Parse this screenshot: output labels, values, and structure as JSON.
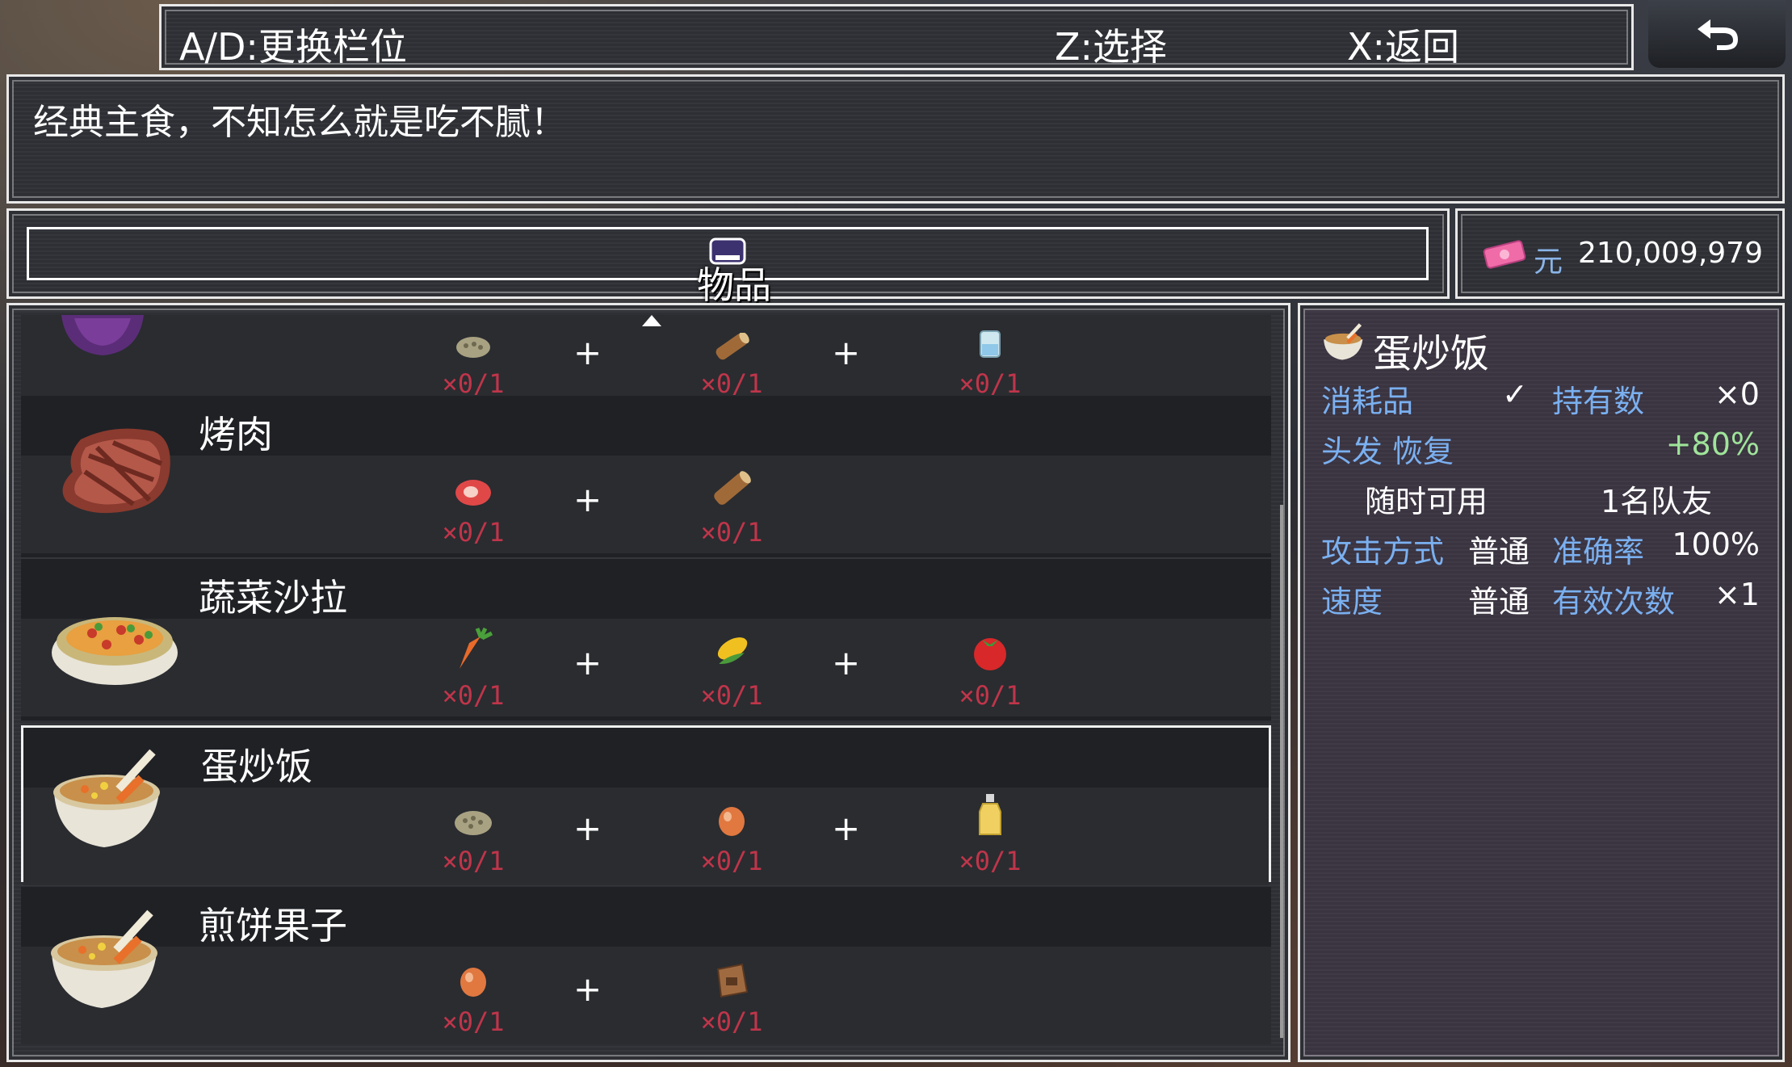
{
  "header": {
    "hint_switch": "A/D:更换栏位",
    "hint_select": "Z:选择",
    "hint_back": "X:返回",
    "back_icon": "return-arrow-icon"
  },
  "description": "经典主食，不知怎么就是吃不腻！",
  "category": {
    "label": "物品",
    "icon": "bag-icon"
  },
  "money": {
    "icon": "banknote-icon",
    "unit": "元",
    "value": "210,009,979"
  },
  "recipes": [
    {
      "name": "",
      "icon": "purple-bowl-icon",
      "ingredients": [
        {
          "icon": "grain-icon",
          "count": "×0/1"
        },
        {
          "icon": "wood-icon",
          "count": "×0/1"
        },
        {
          "icon": "water-cup-icon",
          "count": "×0/1"
        }
      ],
      "plus": "+"
    },
    {
      "name": "烤肉",
      "icon": "steak-icon",
      "ingredients": [
        {
          "icon": "raw-meat-icon",
          "count": "×0/1"
        },
        {
          "icon": "wood-icon",
          "count": "×0/1"
        }
      ],
      "plus": "+"
    },
    {
      "name": "蔬菜沙拉",
      "icon": "salad-icon",
      "ingredients": [
        {
          "icon": "carrot-icon",
          "count": "×0/1"
        },
        {
          "icon": "corn-icon",
          "count": "×0/1"
        },
        {
          "icon": "tomato-icon",
          "count": "×0/1"
        }
      ],
      "plus": "+"
    },
    {
      "name": "蛋炒饭",
      "icon": "fried-rice-icon",
      "selected": true,
      "ingredients": [
        {
          "icon": "grain-icon",
          "count": "×0/1"
        },
        {
          "icon": "egg-icon",
          "count": "×0/1"
        },
        {
          "icon": "oil-bottle-icon",
          "count": "×0/1"
        }
      ],
      "plus": "+"
    },
    {
      "name": "煎饼果子",
      "icon": "fried-rice-icon",
      "ingredients": [
        {
          "icon": "egg-icon",
          "count": "×0/1"
        },
        {
          "icon": "flour-bag-icon",
          "count": "×0/1"
        }
      ],
      "plus": "+"
    }
  ],
  "detail": {
    "title": "蛋炒饭",
    "type_label": "消耗品",
    "type_check": "✓",
    "owned_label": "持有数",
    "owned_value": "×0",
    "effect_label": "头发 恢复",
    "effect_value": "+80%",
    "usable": "随时可用",
    "target": "1名队友",
    "attack_label": "攻击方式",
    "attack_value": "普通",
    "accuracy_label": "准确率",
    "accuracy_value": "100%",
    "speed_label": "速度",
    "speed_value": "普通",
    "uses_label": "有效次数",
    "uses_value": "×1"
  },
  "colors": {
    "accent_blue": "#7ab0f0",
    "count_red": "#c0354a",
    "bonus_green": "#9fe49a"
  }
}
